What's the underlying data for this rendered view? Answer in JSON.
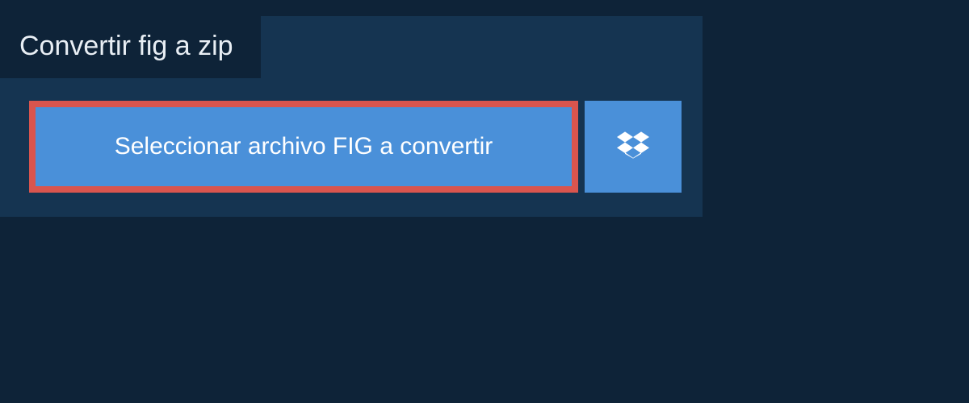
{
  "tab": {
    "label": "Convertir fig a zip"
  },
  "actions": {
    "select_label": "Seleccionar archivo FIG a convertir"
  },
  "colors": {
    "page_bg": "#0e2338",
    "card_bg": "#153451",
    "button_bg": "#4a90d9",
    "highlight_border": "#d9554e",
    "text_light": "#ffffff"
  }
}
